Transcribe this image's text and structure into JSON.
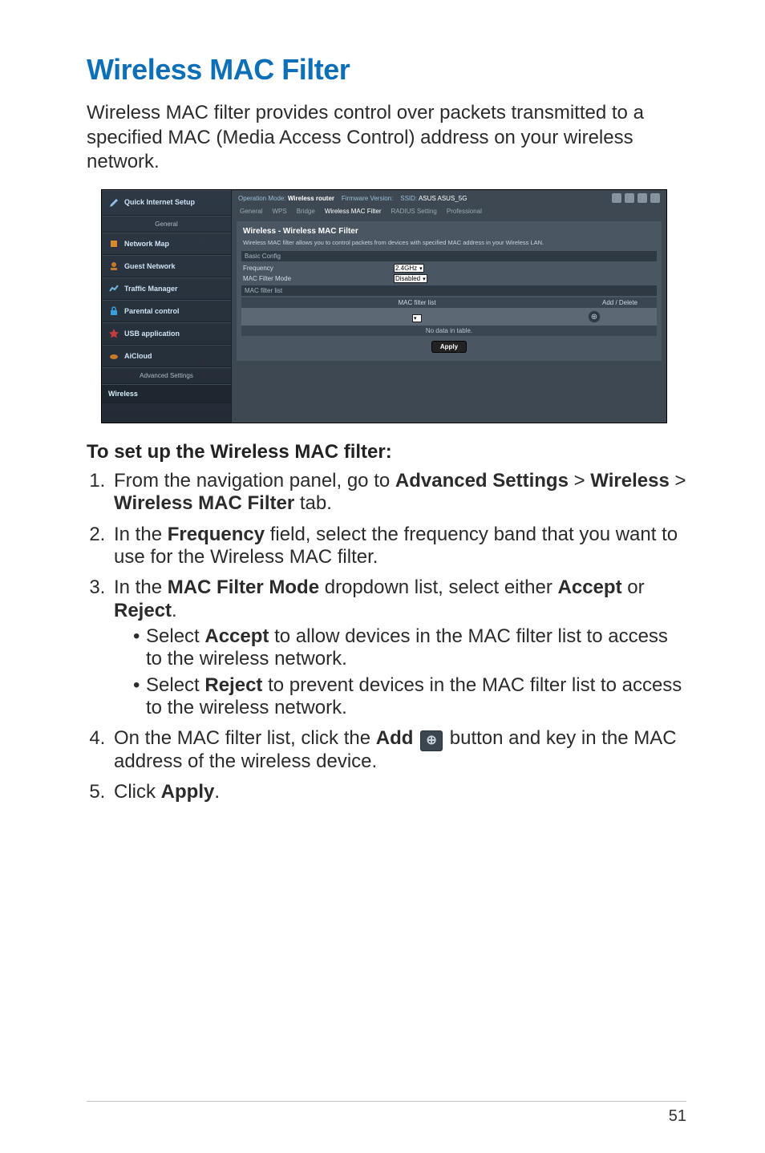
{
  "page_number": "51",
  "title": "Wireless MAC Filter",
  "intro": "Wireless MAC filter provides control over packets transmitted to a specified MAC (Media Access Control) address on your wireless network.",
  "screenshot": {
    "sidebar": {
      "qis": "Quick Internet Setup",
      "head1": "General",
      "items1": [
        "Network Map",
        "Guest Network",
        "Traffic Manager",
        "Parental control",
        "USB application",
        "AiCloud"
      ],
      "head2": "Advanced Settings",
      "items2": [
        "Wireless"
      ]
    },
    "topbar": {
      "left_label": "Operation Mode:",
      "left_value": "Wireless router",
      "fw_label": "Firmware Version:",
      "ssid_label": "SSID:",
      "ssid_value": "ASUS  ASUS_5G"
    },
    "tabs": [
      "General",
      "WPS",
      "Bridge",
      "Wireless MAC Filter",
      "RADIUS Setting",
      "Professional"
    ],
    "panel_title": "Wireless - Wireless MAC Filter",
    "panel_desc": "Wireless MAC filter allows you to control packets from devices with specified MAC address in your Wireless LAN.",
    "sub_basic": "Basic Config",
    "row_freq_label": "Frequency",
    "row_freq_value": "2.4GHz",
    "row_mode_label": "MAC Filter Mode",
    "row_mode_value": "Disabled",
    "sub_list": "MAC filter list",
    "col1": "MAC filter list",
    "col2": "Add / Delete",
    "nodata": "No data in table.",
    "apply": "Apply"
  },
  "section_head": "To set up the Wireless MAC filter:",
  "steps": {
    "s1a": "From the navigation panel, go to ",
    "s1b": "Advanced Settings",
    "s1c": " > ",
    "s1d": "Wireless",
    "s1e": " > ",
    "s1f": "Wireless MAC Filter",
    "s1g": " tab.",
    "s2a": "In the ",
    "s2b": "Frequency",
    "s2c": " field, select the frequency band that you want to use for the Wireless MAC filter.",
    "s3a": "In the ",
    "s3b": "MAC Filter Mode",
    "s3c": " dropdown list, select either ",
    "s3d": "Accept",
    "s3e": " or ",
    "s3f": "Reject",
    "s3g": ".",
    "b1a": "Select ",
    "b1b": "Accept",
    "b1c": " to allow devices in the MAC filter list to access to the wireless network.",
    "b2a": "Select ",
    "b2b": "Reject",
    "b2c": " to prevent devices in the MAC filter list to access to the wireless network.",
    "s4a": "On the MAC filter list, click the ",
    "s4b": "Add",
    "s4c": "  button and key in the MAC address of the wireless device.",
    "s5a": "Click ",
    "s5b": "Apply",
    "s5c": "."
  }
}
